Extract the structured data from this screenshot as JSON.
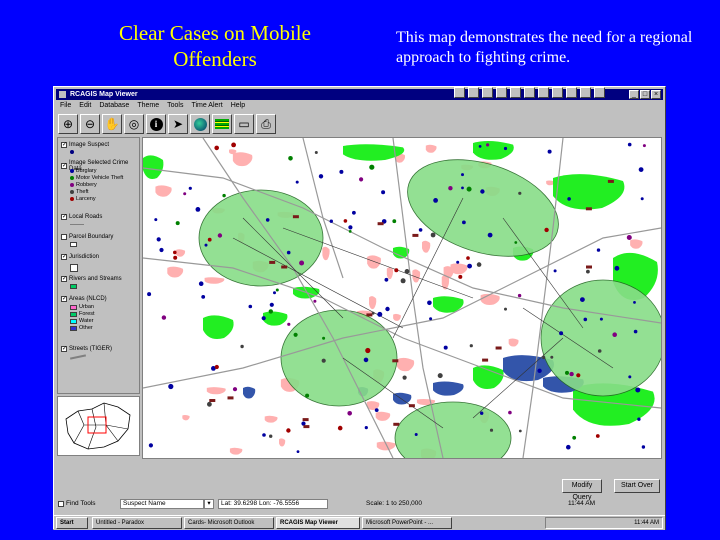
{
  "slide": {
    "title": "Clear Cases on Mobile Offenders",
    "note": "This map demonstrates the need for a regional approach to fighting crime."
  },
  "window": {
    "title": "RCAGIS Map Viewer",
    "controls": [
      "_",
      "□",
      "×"
    ]
  },
  "menu": [
    "File",
    "Edit",
    "Database",
    "Theme",
    "Tools",
    "Time Alert",
    "Help"
  ],
  "toolbar": {
    "tools": [
      "zoom-in",
      "zoom-out",
      "pan",
      "full-extent",
      "identify",
      "select",
      "globe",
      "layers",
      "clipboard",
      "print"
    ]
  },
  "legend": {
    "layers": [
      {
        "label": "Image Suspect",
        "checked": true
      },
      {
        "label": "Image Selected Crime Data",
        "checked": true
      },
      {
        "label": "Local Roads",
        "checked": true
      },
      {
        "label": "Parcel Boundary",
        "checked": false
      },
      {
        "label": "Jurisdiction",
        "checked": true
      },
      {
        "label": "Rivers and Streams",
        "checked": true
      },
      {
        "label": "Areas (NLCD)",
        "checked": true
      },
      {
        "label": "Streets (TIGER)",
        "checked": true
      }
    ],
    "crime_types": [
      {
        "label": "Burglary",
        "color": "#0000a0"
      },
      {
        "label": "Motor Vehicle Theft",
        "color": "#008000"
      },
      {
        "label": "Robbery",
        "color": "#800080"
      },
      {
        "label": "Theft",
        "color": "#404040"
      },
      {
        "label": "Larceny",
        "color": "#a00000"
      }
    ],
    "landuse": [
      {
        "label": "Urban",
        "color": "#ff66cc"
      },
      {
        "label": "Forest",
        "color": "#00cc66"
      },
      {
        "label": "Water",
        "color": "#00ffff"
      },
      {
        "label": "Other",
        "color": "#3333cc"
      }
    ]
  },
  "status": {
    "find_label": "Find Tools",
    "layer_select": "Suspect Name",
    "coordinates": "Lat: 39.6298 Lon: -76.5556",
    "scale": "Scale: 1 to 250,000",
    "time": "11:44 AM",
    "query_button": "Modify Query",
    "clear_button": "Start Over"
  },
  "taskbar": {
    "start": "Start",
    "tasks": [
      "Untitled - Paradox",
      "Cards- Microsoft Outlook",
      "RCAGIS Map Viewer",
      "Microsoft PowerPoint - ..."
    ],
    "clock": "11:44 AM"
  },
  "colors": {
    "slide_bg": "#0000ff",
    "title": "#ffff00",
    "buffer": "#88dd88",
    "forest": "#22ee22",
    "urban": "#ffb0b0",
    "water": "#3355aa"
  }
}
